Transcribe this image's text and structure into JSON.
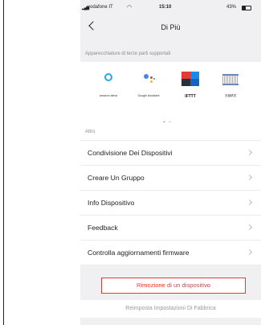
{
  "status_bar": {
    "carrier": "vodafone IT",
    "time": "15:10",
    "battery": "43%"
  },
  "nav": {
    "title": "Di Più"
  },
  "partners": {
    "header": "Apparecchiature di terze parti supportati",
    "items": [
      {
        "label": "amazon alexa",
        "icon": "alexa-icon"
      },
      {
        "label": "Google Assistant",
        "icon": "google-assistant-icon"
      },
      {
        "label": "IFTTT",
        "icon": "ifttt-icon"
      },
      {
        "label": "天猫精灵",
        "icon": "tmall-genie-icon"
      }
    ],
    "page_count": 2,
    "active_page": 1
  },
  "more": {
    "header": "Altro",
    "items": [
      {
        "label": "Condivisione Dei Dispositivi"
      },
      {
        "label": "Creare Un Gruppo"
      },
      {
        "label": "Info Dispositivo"
      },
      {
        "label": "Feedback"
      },
      {
        "label": "Controlla aggiornamenti firmware"
      }
    ]
  },
  "actions": {
    "remove_label": "Rimozione di un dispositivo",
    "reset_label": "Reimposta Impostazioni Di Fabbrica"
  },
  "colors": {
    "danger": "#e53935",
    "alexa": "#2aa6df"
  }
}
